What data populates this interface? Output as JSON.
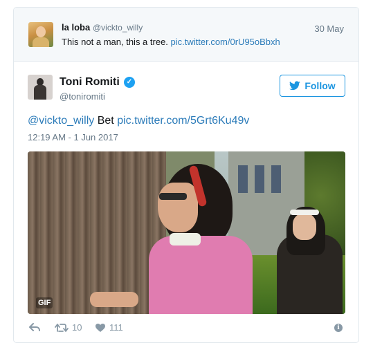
{
  "parent_tweet": {
    "name": "la loba",
    "handle": "@vickto_willy",
    "date": "30 May",
    "text": "This not a man, this a tree.",
    "link": "pic.twitter.com/0rU95oBbxh"
  },
  "tweet": {
    "name": "Toni Romiti",
    "handle": "@toniromiti",
    "follow_label": "Follow",
    "reply_to": "@vickto_willy",
    "text": "Bet",
    "link": "pic.twitter.com/5Grt6Ku49v",
    "timestamp": "12:19 AM - 1 Jun 2017",
    "media_badge": "GIF",
    "retweets": "10",
    "likes": "111"
  },
  "icons": [
    "avatar",
    "verified-badge-icon",
    "twitter-bird-icon",
    "reply-icon",
    "retweet-icon",
    "heart-icon",
    "info-icon"
  ],
  "colors": {
    "link": "#2b7bb9",
    "accent": "#1da1f2",
    "follow": "#1b95e0",
    "muted": "#657786",
    "action": "#8899a6"
  }
}
